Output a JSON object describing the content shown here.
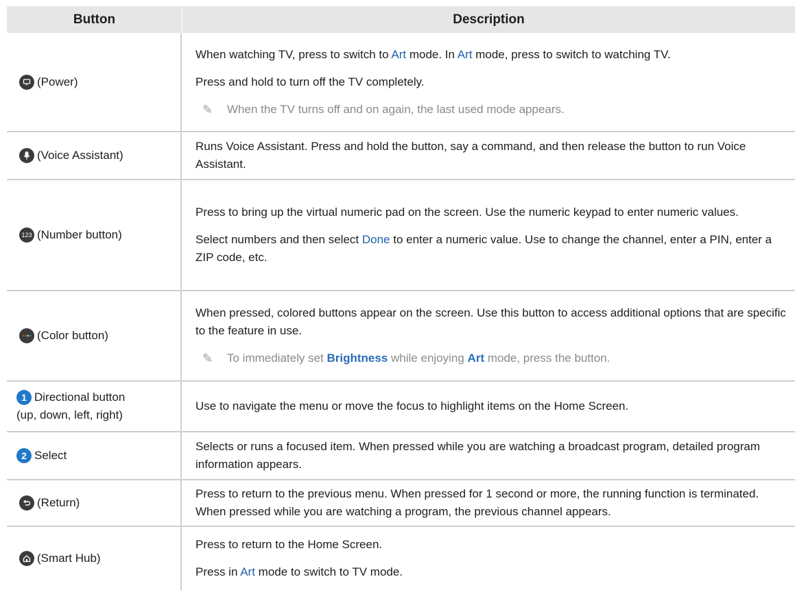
{
  "header": {
    "col_button": "Button",
    "col_description": "Description"
  },
  "rows": [
    {
      "button": "(Power)",
      "icon": "power-icon",
      "desc": [
        [
          "When watching TV, press to switch to ",
          "Art",
          " mode. In ",
          "Art",
          " mode, press to switch to watching TV."
        ],
        "Press and hold to turn off the TV completely."
      ],
      "note": "When the TV turns off and on again, the last used mode appears."
    },
    {
      "button": "(Voice Assistant)",
      "icon": "microphone-icon",
      "desc": "Runs Voice Assistant. Press and hold the button, say a command, and then release the button to run Voice Assistant."
    },
    {
      "button": "(Number button)",
      "icon": "number-pad-icon",
      "icon_text": "123",
      "desc_1": "Press to bring up the virtual numeric pad on the screen. Use the numeric keypad to enter numeric values.",
      "desc_2": [
        "Select numbers and then select ",
        "Done",
        " to enter a numeric value. Use to change the channel, enter a PIN, enter a ZIP code, etc."
      ]
    },
    {
      "button": "(Color button)",
      "icon": "color-button-icon",
      "desc": "When pressed, colored buttons appear on the screen. Use this button to access additional options that are specific to the feature in use.",
      "note": [
        "To immediately set ",
        "Brightness",
        " while enjoying ",
        "Art",
        " mode, press the button."
      ]
    },
    {
      "button_line1": "Directional button",
      "button_line2": "(up, down, left, right)",
      "icon": "number-1-icon",
      "icon_text": "1",
      "desc": "Use to navigate the menu or move the focus to highlight items on the Home Screen."
    },
    {
      "button": "Select",
      "icon": "number-2-icon",
      "icon_text": "2",
      "desc": "Selects or runs a focused item. When pressed while you are watching a broadcast program, detailed program information appears."
    },
    {
      "button": "(Return)",
      "icon": "return-icon",
      "desc": "Press to return to the previous menu. When pressed for 1 second or more, the running function is terminated. When pressed while you are watching a program, the previous channel appears."
    },
    {
      "button": "(Smart Hub)",
      "icon": "home-icon",
      "desc_1": "Press to return to the Home Screen.",
      "desc_2": [
        "Press in ",
        "Art",
        " mode to switch to TV mode."
      ]
    }
  ],
  "colors": {
    "highlight": "#1e5fa8",
    "header_bg": "#e6e6e6",
    "icon_bg": "#3b3b3b",
    "number_icon_bg": "#1f78c8"
  }
}
